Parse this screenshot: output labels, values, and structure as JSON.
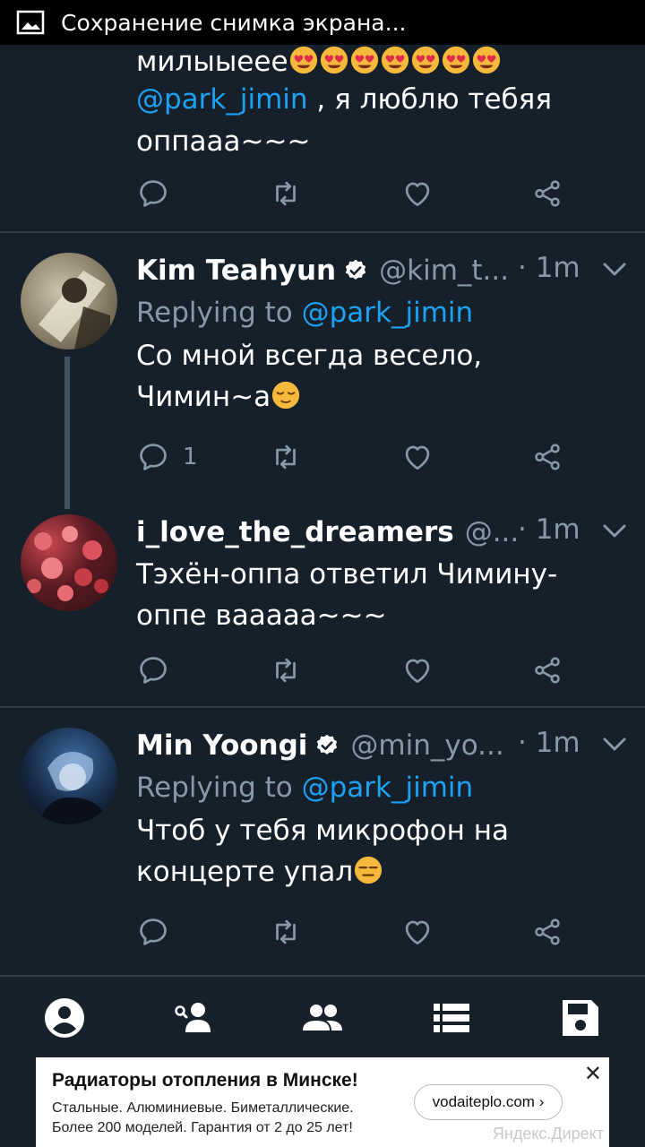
{
  "status_bar": {
    "notification": "Сохранение снимка экрана..."
  },
  "tweets": [
    {
      "text_part1": "милыыеее",
      "mention": "@park_jimin",
      "text_part2": " , я люблю тебяя",
      "text_part3": "оппааа~~~"
    },
    {
      "name": "Kim Teahyun",
      "verified": true,
      "handle": "@kim_t...",
      "time": "· 1m",
      "replying_prefix": "Replying to ",
      "replying_to": "@park_jimin",
      "text_line1": "Со мной всегда весело,",
      "text_line2": "Чимин~а",
      "reply_count": "1"
    },
    {
      "name": "i_love_the_dreamers",
      "handle": "@...",
      "time": "· 1m",
      "text_line1": "Тэхён-оппа ответил Чимину-",
      "text_line2": "оппе вааааа~~~"
    },
    {
      "name": "Min Yoongi",
      "verified": true,
      "handle": "@min_yo...",
      "time": "· 1m",
      "replying_prefix": "Replying to ",
      "replying_to": "@park_jimin",
      "text_line1": "Чтоб у тебя микрофон на",
      "text_line2": "концерте упал"
    }
  ],
  "bottom_nav": [
    "profile-icon",
    "follow-user-icon",
    "people-icon",
    "list-icon",
    "save-icon"
  ],
  "ad": {
    "title": "Радиаторы отопления в Минске!",
    "body_line1": "Стальные. Алюминиевые. Биметаллические.",
    "body_line2": "Более 200 моделей. Гарантия от 2 до 25 лет!",
    "button": "vodaiteplo.com ›",
    "close": "✕",
    "brand": "Яндекс.Директ"
  },
  "colors": {
    "background": "#15202b",
    "accent": "#1da1f2",
    "secondary_text": "#8899a6",
    "divider": "#2f3b47"
  }
}
